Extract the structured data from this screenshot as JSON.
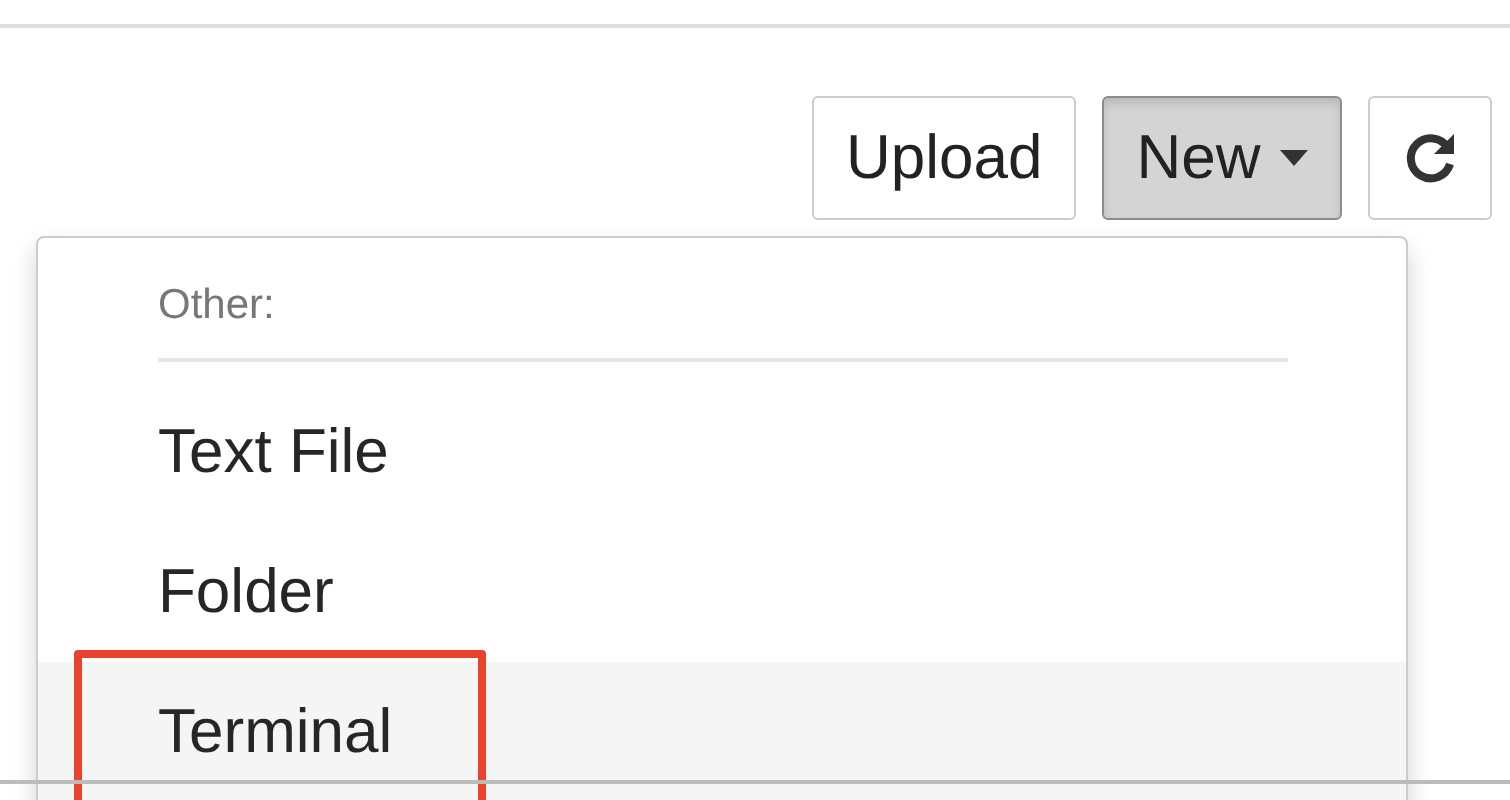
{
  "toolbar": {
    "buttons": [
      {
        "label": "Upload",
        "kind": "plain",
        "pressed": false
      },
      {
        "label": "New",
        "kind": "dropdown",
        "pressed": true
      },
      {
        "kind": "refresh",
        "pressed": false
      }
    ]
  },
  "menu": {
    "header": "Other:",
    "items": [
      {
        "label": "Text File",
        "highlighted": false,
        "annotated": false
      },
      {
        "label": "Folder",
        "highlighted": false,
        "annotated": false
      },
      {
        "label": "Terminal",
        "highlighted": true,
        "annotated": true
      }
    ]
  }
}
